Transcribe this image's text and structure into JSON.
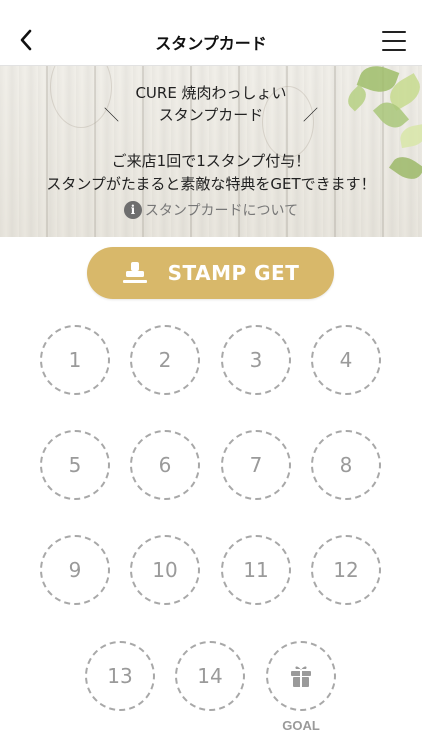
{
  "header": {
    "title": "スタンプカード"
  },
  "hero": {
    "store_name": "CURE 焼肉わっしょい",
    "card_title": "スタンプカード",
    "deco_left": "＼",
    "deco_right": "／",
    "desc_line1": "ご来店1回で1スタンプ付与！",
    "desc_line2": "スタンプがたまると素敵な特典をGETできます！",
    "about_link": "スタンプカードについて"
  },
  "stamp_button": {
    "label": "STAMP GET"
  },
  "slots": [
    "1",
    "2",
    "3",
    "4",
    "5",
    "6",
    "7",
    "8",
    "9",
    "10",
    "11",
    "12",
    "13",
    "14"
  ],
  "goal": {
    "label": "GOAL"
  },
  "colors": {
    "accent": "#d8b86a",
    "slot_border": "#a8a8a8",
    "slot_text": "#9a9a9a"
  }
}
